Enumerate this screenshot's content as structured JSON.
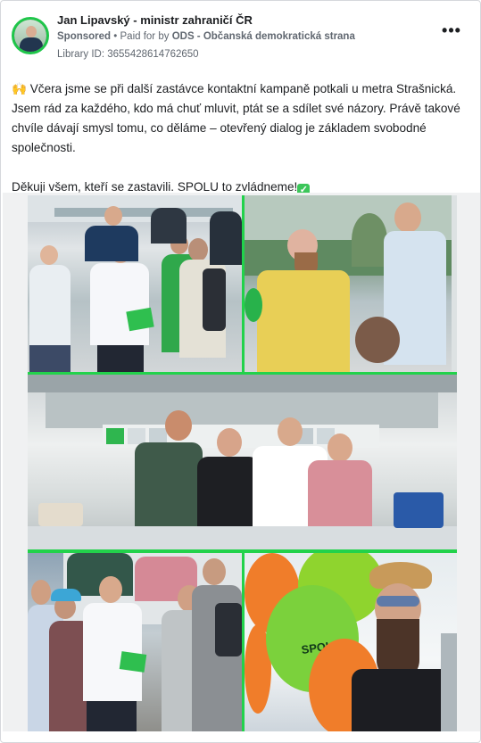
{
  "post": {
    "page_name": "Jan Lipavský - ministr zahraničí ČR",
    "sponsored_label": "Sponsored",
    "paid_by_prefix": "Paid for by",
    "paid_by": "ODS - Občanská demokratická strana",
    "library_id": "Library ID: 3655428614762650",
    "more_icon": "more-options-icon",
    "text_paragraph_1": "🙌 Včera jsme se při další zastávce kontaktní kampaně potkali u metra Strašnická. Jsem rád za každého, kdo má chuť mluvit, ptát se a sdílet své názory. Právě takové chvíle dávají smysl tomu, co děláme – otevřený dialog je základem svobodné společnosti.",
    "text_paragraph_2": "Děkuji všem, kteří se zastavili. SPOLU to zvládneme!",
    "check_emoji": "✓"
  },
  "collage": {
    "accent_color": "#22d24b",
    "balloon_text": "SPOLU"
  }
}
